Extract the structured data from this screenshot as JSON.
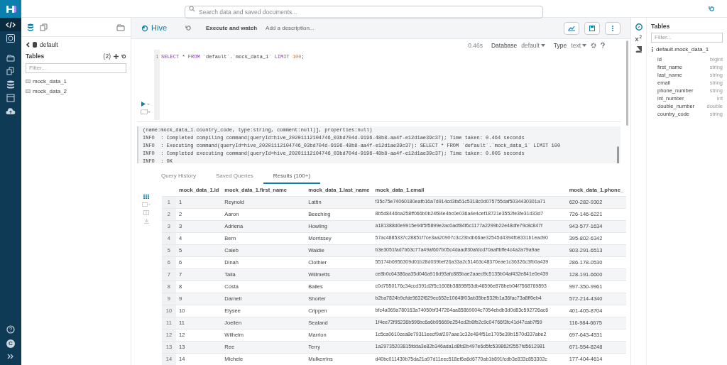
{
  "nav": {
    "items": [
      {
        "selected": true
      },
      {
        "selected": false
      },
      {
        "selected": false
      },
      {
        "selected": false
      },
      {
        "selected": false
      },
      {
        "selected": false
      },
      {
        "selected": false
      }
    ],
    "user_initial": "C"
  },
  "search": {
    "placeholder": "Search data and saved documents..."
  },
  "left_panel": {
    "database": "default",
    "tables_heading": "Tables",
    "count": "(2)",
    "filter_placeholder": "Filter...",
    "tables": [
      "mock_data_1",
      "mock_data_2"
    ]
  },
  "editor": {
    "app": "Hive",
    "execute": "Execute and watch",
    "description_placeholder": "Add a description...",
    "duration": "0.46s",
    "database_label": "Database",
    "database": "default",
    "type_label": "Type",
    "type": "text",
    "line_number": "1",
    "code": [
      {
        "kind": "keyword",
        "text": "SELECT"
      },
      {
        "kind": "plain",
        "text": " * "
      },
      {
        "kind": "keyword",
        "text": "FROM"
      },
      {
        "kind": "plain",
        "text": " `default`.`mock_data_1` "
      },
      {
        "kind": "keyword",
        "text": "LIMIT"
      },
      {
        "kind": "number",
        "text": "100"
      },
      {
        "kind": "plain",
        "text": ";"
      }
    ]
  },
  "log": [
    "(name:mock_data_1.country_code, type:string, comment:null)], properties:null)",
    "INFO  : Completed compiling command(queryId=hive_20201112104746_03bd704d-9196-48b8-aa4f-e12d1ae39c37); Time taken: 0.464 seconds",
    "INFO  : Executing command(queryId=hive_20201112104746_03bd704d-9196-48b8-aa4f-e12d1ae39c37): SELECT * FROM `default`.`mock_data_1` LIMIT 100",
    "INFO  : Completed executing command(queryId=hive_20201112104746_03bd704d-9196-48b8-aa4f-e12d1ae39c37); Time taken: 0.005 seconds",
    "INFO  : OK"
  ],
  "result_tabs": [
    {
      "label": "Query History",
      "selected": false
    },
    {
      "label": "Saved Queries",
      "selected": false
    },
    {
      "label": "Results (100+)",
      "selected": true
    }
  ],
  "table": {
    "columns": [
      "mock_data_1.id",
      "mock_data_1.first_name",
      "mock_data_1.last_name",
      "mock_data_1.email",
      "mock_data_1.phone_"
    ],
    "rows": [
      {
        "n": "1",
        "cells": [
          "1",
          "Reynold",
          "Lattin",
          "f35c75e74060180eafb16a7d914cd3fa51c5318c0d075755daf5034430301a71",
          "620-282-9302"
        ]
      },
      {
        "n": "2",
        "cells": [
          "2",
          "Aaron",
          "Beeching",
          "8b5d8446ba258ff066b0b24f84e4bc0e036a4e4cef18721e3552fe3fe31d33d7",
          "726-146-6221"
        ]
      },
      {
        "n": "3",
        "cells": [
          "3",
          "Adriena",
          "Howling",
          "a181388d0e9915e94f5f5899e2ac0adf84f6c1177a2299b22e48dfe79c8c847f",
          "943-577-1634"
        ]
      },
      {
        "n": "4",
        "cells": [
          "4",
          "Bern",
          "Morrissey",
          "57ac4885337c28851f7ce3aa20907c3c23bdb66ae32545d4394fb8331b1ead90",
          "395-802-6342"
        ]
      },
      {
        "n": "5",
        "cells": [
          "5",
          "Caleb",
          "Waldie",
          "b3e3051fad7b63c77a49af607b05c4daadf30afdcd70aaffbffe4c4a2a79a9ae",
          "903-291-6513"
        ]
      },
      {
        "n": "6",
        "cells": [
          "6",
          "Dinah",
          "Clothier",
          "55174b6956309d01b28d039bef26a33a2c51463c48370eae1c36326c3fb0a439",
          "286-178-0530"
        ]
      },
      {
        "n": "7",
        "cells": [
          "7",
          "Talia",
          "Willmetts",
          "ce8b0c64386aa35d046a916d93afc885bae2aaed9c5135b04af432e841e0e439",
          "128-191-6600"
        ]
      },
      {
        "n": "8",
        "cells": [
          "8",
          "Costa",
          "Bailes",
          "c0d7550176c34ccd391d2f5c1608b38898f53db46596e878beb04f7568769893",
          "997-350-9961"
        ]
      },
      {
        "n": "9",
        "cells": [
          "9",
          "Darnell",
          "Shorter",
          "b2ba7824b9cfde9632f629ec652e10648f03ab35be532fb1a36fac73a8ff0eb4",
          "572-214-4340"
        ]
      },
      {
        "n": "10",
        "cells": [
          "10",
          "Elysee",
          "Crippen",
          "bfc4a069a780163a74050bf347264aa85869004c7054ebdb3d0d83c592726ac6",
          "401-405-8704"
        ]
      },
      {
        "n": "11",
        "cells": [
          "11",
          "Joellen",
          "Sealand",
          "1f4ee72f95236b596bc6a6b95669e254cd2b8fb2c9c04766f3fc41d47cab7f59",
          "116-984-6675"
        ]
      },
      {
        "n": "12",
        "cells": [
          "12",
          "Wilhelm",
          "Marrion",
          "1c5ca0610cea8e79311eecf9af207aae1c32e484f51e1705e39b1570d337abe2",
          "697-643-4531"
        ]
      },
      {
        "n": "13",
        "cells": [
          "13",
          "Ree",
          "Terry",
          "1a29735203815fdda3e82b346ada1d8fd2b497e6d5fc539862f2557fd5612981",
          "671-554-8248"
        ]
      },
      {
        "n": "14",
        "cells": [
          "14",
          "Michele",
          "Mulkerrins",
          "d40bc011430b75da21a97d11eec518ef6a6d6770ab1b891fcdb3e833c853302c",
          "177-404-4614"
        ]
      }
    ]
  },
  "right_panel": {
    "title": "Tables",
    "filter_placeholder": "Filter...",
    "table": "default.mock_data_1",
    "columns": [
      {
        "name": "id",
        "type": "bigint"
      },
      {
        "name": "first_name",
        "type": "string"
      },
      {
        "name": "last_name",
        "type": "string"
      },
      {
        "name": "email",
        "type": "string"
      },
      {
        "name": "phone_number",
        "type": "string"
      },
      {
        "name": "int_number",
        "type": "int"
      },
      {
        "name": "double_number",
        "type": "double"
      },
      {
        "name": "country_code",
        "type": "string"
      }
    ]
  }
}
